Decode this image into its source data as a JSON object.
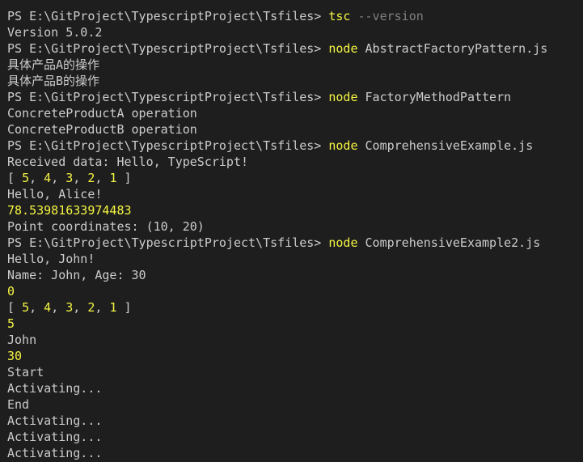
{
  "terminal": {
    "prompt": "PS E:\\GitProject\\TypescriptProject\\Tsfiles> ",
    "colors": {
      "background": "#1e1e1e",
      "text": "#cccccc",
      "command": "#f5f543",
      "flag": "#808080",
      "number": "#f5f543"
    },
    "commands": {
      "tsc": "tsc",
      "tsc_flag": "--version",
      "node": "node",
      "abstract_factory": "AbstractFactoryPattern.js",
      "factory_method": "FactoryMethodPattern",
      "comprehensive": "ComprehensiveExample.js",
      "comprehensive2": "ComprehensiveExample2.js"
    },
    "output": {
      "version": "Version 5.0.2",
      "product_a_cn": "具体产品A的操作",
      "product_b_cn": "具体产品B的操作",
      "concrete_a": "ConcreteProductA operation",
      "concrete_b": "ConcreteProductB operation",
      "received": "Received data: Hello, TypeScript!",
      "array_open": "[ ",
      "array_sep": ", ",
      "array_close": " ]",
      "array_values": [
        "5",
        "4",
        "3",
        "2",
        "1"
      ],
      "hello_alice": "Hello, Alice!",
      "area": "78.53981633974483",
      "point": "Point coordinates: (10, 20)",
      "hello_john": "Hello, John!",
      "name_age": "Name: John, Age: 30",
      "zero": "0",
      "five": "5",
      "john": "John",
      "thirty": "30",
      "start": "Start",
      "activating": "Activating...",
      "end": "End"
    }
  }
}
